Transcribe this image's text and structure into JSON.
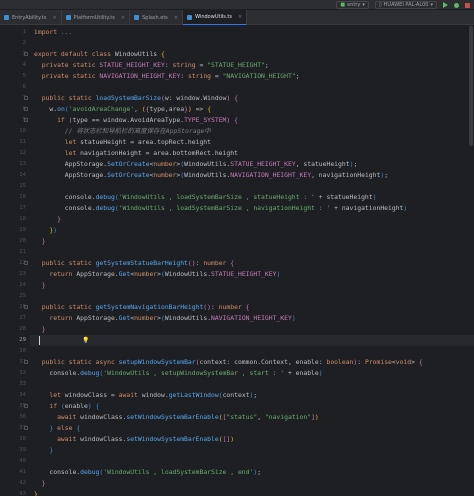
{
  "run_toolbar": {
    "config": "entry",
    "device": "HUAWEI PAL-AL00"
  },
  "tabs": [
    {
      "label": "EntryAbility.ts"
    },
    {
      "label": "PlatformUtility.ts"
    },
    {
      "label": "Splash.ets"
    },
    {
      "label": "WindowUtils.ts",
      "active": true
    }
  ],
  "editor": {
    "current_line": 29,
    "lines": [
      {
        "n": "1",
        "t": [
          [
            "k",
            "import "
          ],
          [
            "c",
            "..."
          ]
        ]
      },
      {
        "n": "2",
        "t": []
      },
      {
        "n": "3",
        "t": [
          [
            "k",
            "export default class "
          ],
          [
            "n",
            "WindowUtils "
          ],
          [
            "yb",
            "{"
          ]
        ]
      },
      {
        "n": "4",
        "t": [
          [
            "k",
            "  private static "
          ],
          [
            "fld",
            "STATUE_HEIGHT_KEY"
          ],
          [
            "p",
            ": "
          ],
          [
            "k",
            "string "
          ],
          [
            "p",
            "= "
          ],
          [
            "s",
            "\"STATUE_HEIGHT\""
          ],
          [
            "p",
            ";"
          ]
        ]
      },
      {
        "n": "5",
        "t": [
          [
            "k",
            "  private static "
          ],
          [
            "fld",
            "NAVIGATION_HEIGHT_KEY"
          ],
          [
            "p",
            ": "
          ],
          [
            "k",
            "string "
          ],
          [
            "p",
            "= "
          ],
          [
            "s",
            "\"NAVIGATION_HEIGHT\""
          ],
          [
            "p",
            ";"
          ]
        ]
      },
      {
        "n": "6",
        "t": []
      },
      {
        "n": "7",
        "t": [
          [
            "k",
            "  public static "
          ],
          [
            "f",
            "loadSystemBarSize"
          ],
          [
            "pb",
            "("
          ],
          [
            "n",
            "w"
          ],
          [
            "p",
            ": "
          ],
          [
            "n",
            "window.Window"
          ],
          [
            "pb",
            ")"
          ],
          [
            "p",
            " "
          ],
          [
            "pb",
            "{"
          ]
        ]
      },
      {
        "n": "8",
        "t": [
          [
            "n",
            "    w."
          ],
          [
            "f",
            "on"
          ],
          [
            "bb",
            "("
          ],
          [
            "s",
            "'avoidAreaChange'"
          ],
          [
            "p",
            ", "
          ],
          [
            "yb",
            "("
          ],
          [
            "pb",
            "{"
          ],
          [
            "n",
            "type,area"
          ],
          [
            "pb",
            "}"
          ],
          [
            "yb",
            ")"
          ],
          [
            "p",
            " => "
          ],
          [
            "yb",
            "{"
          ]
        ]
      },
      {
        "n": "9",
        "t": [
          [
            "k",
            "      if "
          ],
          [
            "pb",
            "("
          ],
          [
            "n",
            "type == window.AvoidAreaType."
          ],
          [
            "fld",
            "TYPE_SYSTEM"
          ],
          [
            "pb",
            ")"
          ],
          [
            "p",
            " "
          ],
          [
            "pb",
            "{"
          ]
        ]
      },
      {
        "n": "10",
        "t": [
          [
            "c",
            "        // 将状态栏和导航栏的高度保存在AppStorage中"
          ]
        ]
      },
      {
        "n": "11",
        "t": [
          [
            "k",
            "        let "
          ],
          [
            "n",
            "statueHeight = area.topRect.height"
          ]
        ]
      },
      {
        "n": "12",
        "t": [
          [
            "k",
            "        let "
          ],
          [
            "n",
            "navigationHeight = area.bottomRect.height"
          ]
        ]
      },
      {
        "n": "13",
        "t": [
          [
            "n",
            "        AppStorage."
          ],
          [
            "f",
            "SetOrCreate"
          ],
          [
            "p",
            "<"
          ],
          [
            "k",
            "number"
          ],
          [
            "p",
            ">"
          ],
          [
            "bb",
            "("
          ],
          [
            "n",
            "WindowUtils."
          ],
          [
            "fld",
            "STATUE_HEIGHT_KEY"
          ],
          [
            "p",
            ", statueHeight"
          ],
          [
            "bb",
            ")"
          ],
          [
            "p",
            ";"
          ]
        ]
      },
      {
        "n": "14",
        "t": [
          [
            "n",
            "        AppStorage."
          ],
          [
            "f",
            "SetOrCreate"
          ],
          [
            "p",
            "<"
          ],
          [
            "k",
            "number"
          ],
          [
            "p",
            ">"
          ],
          [
            "bb",
            "("
          ],
          [
            "n",
            "WindowUtils."
          ],
          [
            "fld",
            "NAVIGATION_HEIGHT_KEY"
          ],
          [
            "p",
            ", navigationHeight"
          ],
          [
            "bb",
            ")"
          ],
          [
            "p",
            ";"
          ]
        ]
      },
      {
        "n": "15",
        "t": []
      },
      {
        "n": "16",
        "t": [
          [
            "n",
            "        console."
          ],
          [
            "f",
            "debug"
          ],
          [
            "bb",
            "("
          ],
          [
            "s",
            "'WindowUtils , loadSystemBarSize , statueHeight : '"
          ],
          [
            "p",
            " + statueHeight"
          ],
          [
            "bb",
            ")"
          ]
        ]
      },
      {
        "n": "17",
        "t": [
          [
            "n",
            "        console."
          ],
          [
            "f",
            "debug"
          ],
          [
            "bb",
            "("
          ],
          [
            "s",
            "'WindowUtils , loadSystemBarSize , navigationHeight : '"
          ],
          [
            "p",
            " + navigationHeight"
          ],
          [
            "bb",
            ")"
          ]
        ]
      },
      {
        "n": "18",
        "t": [
          [
            "pb",
            "      }"
          ]
        ]
      },
      {
        "n": "19",
        "t": [
          [
            "yb",
            "    }"
          ],
          [
            "bb",
            ")"
          ]
        ]
      },
      {
        "n": "20",
        "t": [
          [
            "pb",
            "  }"
          ]
        ]
      },
      {
        "n": "21",
        "t": []
      },
      {
        "n": "22",
        "t": [
          [
            "k",
            "  public static "
          ],
          [
            "f",
            "getSystemStatueBarHeight"
          ],
          [
            "pb",
            "()"
          ],
          [
            "p",
            ": "
          ],
          [
            "k",
            "number "
          ],
          [
            "pb",
            "{"
          ]
        ]
      },
      {
        "n": "23",
        "t": [
          [
            "k",
            "    return "
          ],
          [
            "n",
            "AppStorage."
          ],
          [
            "f",
            "Get"
          ],
          [
            "p",
            "<"
          ],
          [
            "k",
            "number"
          ],
          [
            "p",
            ">"
          ],
          [
            "bb",
            "("
          ],
          [
            "n",
            "WindowUtils."
          ],
          [
            "fld",
            "STATUE_HEIGHT_KEY"
          ],
          [
            "bb",
            ")"
          ]
        ]
      },
      {
        "n": "24",
        "t": [
          [
            "pb",
            "  }"
          ]
        ]
      },
      {
        "n": "25",
        "t": []
      },
      {
        "n": "26",
        "t": [
          [
            "k",
            "  public static "
          ],
          [
            "f",
            "getSystemNavigationBarHeight"
          ],
          [
            "pb",
            "()"
          ],
          [
            "p",
            ": "
          ],
          [
            "k",
            "number "
          ],
          [
            "pb",
            "{"
          ]
        ]
      },
      {
        "n": "27",
        "t": [
          [
            "k",
            "    return "
          ],
          [
            "n",
            "AppStorage."
          ],
          [
            "f",
            "Get"
          ],
          [
            "p",
            "<"
          ],
          [
            "k",
            "number"
          ],
          [
            "p",
            ">"
          ],
          [
            "bb",
            "("
          ],
          [
            "n",
            "WindowUtils."
          ],
          [
            "fld",
            "NAVIGATION_HEIGHT_KEY"
          ],
          [
            "bb",
            ")"
          ]
        ]
      },
      {
        "n": "28",
        "t": [
          [
            "pb",
            "  }"
          ]
        ]
      },
      {
        "n": "29",
        "t": []
      },
      {
        "n": "30",
        "t": []
      },
      {
        "n": "31",
        "t": [
          [
            "k",
            "  public static async "
          ],
          [
            "f",
            "setupWindowSystemBar"
          ],
          [
            "pb",
            "("
          ],
          [
            "n",
            "context"
          ],
          [
            "p",
            ": "
          ],
          [
            "n",
            "common.Context, enable"
          ],
          [
            "p",
            ": "
          ],
          [
            "k",
            "boolean"
          ],
          [
            "pb",
            ")"
          ],
          [
            "p",
            ": "
          ],
          [
            "k",
            "Promise"
          ],
          [
            "p",
            "<"
          ],
          [
            "k",
            "void"
          ],
          [
            "p",
            "> "
          ],
          [
            "pb",
            "{"
          ]
        ]
      },
      {
        "n": "32",
        "t": [
          [
            "n",
            "    console."
          ],
          [
            "f",
            "debug"
          ],
          [
            "bb",
            "("
          ],
          [
            "s",
            "'WindowUtils , setupWindowSystemBar , start : '"
          ],
          [
            "p",
            " + enable"
          ],
          [
            "bb",
            ")"
          ]
        ]
      },
      {
        "n": "33",
        "t": []
      },
      {
        "n": "34",
        "t": [
          [
            "k",
            "    let "
          ],
          [
            "n",
            "windowClass = "
          ],
          [
            "k",
            "await "
          ],
          [
            "n",
            "window."
          ],
          [
            "f",
            "getLastWindow"
          ],
          [
            "bb",
            "("
          ],
          [
            "n",
            "context"
          ],
          [
            "bb",
            ")"
          ],
          [
            "p",
            ";"
          ]
        ]
      },
      {
        "n": "35",
        "t": [
          [
            "k",
            "    if "
          ],
          [
            "bb",
            "("
          ],
          [
            "n",
            "enable"
          ],
          [
            "bb",
            ")"
          ],
          [
            "p",
            " "
          ],
          [
            "bb",
            "{"
          ]
        ]
      },
      {
        "n": "36",
        "t": [
          [
            "k",
            "      await "
          ],
          [
            "n",
            "windowClass."
          ],
          [
            "f",
            "setWindowSystemBarEnable"
          ],
          [
            "yb",
            "("
          ],
          [
            "pb",
            "["
          ],
          [
            "s",
            "\"status\""
          ],
          [
            "p",
            ", "
          ],
          [
            "s",
            "\"navigation\""
          ],
          [
            "pb",
            "]"
          ],
          [
            "yb",
            ")"
          ]
        ]
      },
      {
        "n": "37",
        "t": [
          [
            "bb",
            "    }"
          ],
          [
            "k",
            " else "
          ],
          [
            "bb",
            "{"
          ]
        ]
      },
      {
        "n": "38",
        "t": [
          [
            "k",
            "      await "
          ],
          [
            "n",
            "windowClass."
          ],
          [
            "f",
            "setWindowSystemBarEnable"
          ],
          [
            "yb",
            "("
          ],
          [
            "pb",
            "[]"
          ],
          [
            "yb",
            ")"
          ]
        ]
      },
      {
        "n": "39",
        "t": [
          [
            "bb",
            "    }"
          ]
        ]
      },
      {
        "n": "40",
        "t": []
      },
      {
        "n": "41",
        "t": [
          [
            "n",
            "    console."
          ],
          [
            "f",
            "debug"
          ],
          [
            "bb",
            "("
          ],
          [
            "s",
            "'WindowUtils , loadSystemBarSize , end'"
          ],
          [
            "bb",
            ")"
          ],
          [
            "p",
            ";"
          ]
        ]
      },
      {
        "n": "42",
        "t": [
          [
            "pb",
            "  }"
          ]
        ]
      },
      {
        "n": "43",
        "t": [
          [
            "yb",
            "}"
          ]
        ]
      },
      {
        "n": "44",
        "t": []
      }
    ]
  }
}
